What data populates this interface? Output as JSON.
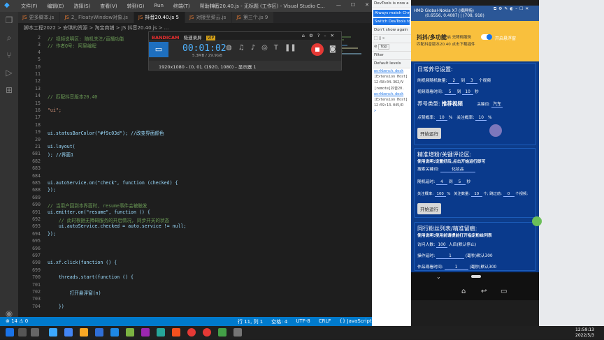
{
  "vscode": {
    "menu": [
      "文件(F)",
      "编辑(E)",
      "选择(S)",
      "查看(V)",
      "转到(G)",
      "Run",
      "终端(T)",
      "帮助(H)"
    ],
    "window_title": "抖音20.40.js - 无标题 (工作区) - Visual Studio C...",
    "tabs": [
      {
        "label": "更多脚本.js",
        "active": false
      },
      {
        "label": "2_ FloatyWindow对象.js",
        "active": false
      },
      {
        "label": "抖音20.40.js 5",
        "active": true
      },
      {
        "label": "对接至菜云.js",
        "active": false
      },
      {
        "label": "第三个.js 9",
        "active": false
      }
    ],
    "breadcrumb": "脚本工程2022 > 安琪的资源 > 淘宝商铺 > JS 抖音20.40.js > ...",
    "lines": [
      {
        "n": "2",
        "t": "  // 视频说明区: 随机关注/直播功能"
      },
      {
        "n": "3",
        "t": "  // 作者Q号: 阿里编程"
      },
      {
        "n": "4",
        "t": ""
      },
      {
        "n": "5",
        "t": ""
      },
      {
        "n": "10",
        "t": ""
      },
      {
        "n": "11",
        "t": ""
      },
      {
        "n": "12",
        "t": ""
      },
      {
        "n": "13",
        "t": ""
      },
      {
        "n": "14",
        "t": "  // 匹配抖音版本20.40"
      },
      {
        "n": "15",
        "t": ""
      },
      {
        "n": "16",
        "t": "  \"ui\";"
      },
      {
        "n": "17",
        "t": ""
      },
      {
        "n": "18",
        "t": ""
      },
      {
        "n": "19",
        "t": "  ui.statusBarColor(\"#f9c03d\"); //改变界面颜色"
      },
      {
        "n": "20",
        "t": ""
      },
      {
        "n": "21",
        "t": "  ui.layout("
      },
      {
        "n": "681",
        "t": "  ); //界面1"
      },
      {
        "n": "682",
        "t": ""
      },
      {
        "n": "683",
        "t": ""
      },
      {
        "n": "684",
        "t": ""
      },
      {
        "n": "685",
        "t": "  ui.autoService.on(\"check\", function (checked) {"
      },
      {
        "n": "688",
        "t": "  });"
      },
      {
        "n": "689",
        "t": ""
      },
      {
        "n": "690",
        "t": "  // 当用户回到本界面时, resume事件会被触发"
      },
      {
        "n": "691",
        "t": "  ui.emitter.on(\"resume\", function () {"
      },
      {
        "n": "692",
        "t": "      // 此时根据无障碍服务的开启情况, 同步开关的状态"
      },
      {
        "n": "693",
        "t": "      ui.autoService.checked = auto.service != null;"
      },
      {
        "n": "694",
        "t": "  });"
      },
      {
        "n": "695",
        "t": ""
      },
      {
        "n": "696",
        "t": ""
      },
      {
        "n": "697",
        "t": ""
      },
      {
        "n": "698",
        "t": "  ui.xf.click(function () {"
      },
      {
        "n": "699",
        "t": ""
      },
      {
        "n": "700",
        "t": "      threads.start(function () {"
      },
      {
        "n": "701",
        "t": ""
      },
      {
        "n": "702",
        "t": "          打开悬浮窗(n)"
      },
      {
        "n": "703",
        "t": ""
      },
      {
        "n": "704",
        "t": "      })"
      }
    ],
    "status_left": "⊗ 14 ⚠ 0",
    "status_right": [
      "行 11, 列 1",
      "空格: 4",
      "UTF-8",
      "CRLF",
      "{} JavaScript"
    ]
  },
  "bandicam": {
    "brand": "BANDICAM",
    "subtitle": "极速录屏",
    "vip": "VIP",
    "time": "00:01:02",
    "size": "5.3MB / 29.9GB",
    "resolution": "1920x1080 - (0, 0), (1920, 1080) - 显示器 1"
  },
  "devtools": {
    "btn1": "Always match Chrome",
    "btn2": "Switch DevTools to",
    "dont_show": "Don't show again",
    "filter": "Filter",
    "levels": "Default levels",
    "top": "top",
    "logs": [
      "workbench.desk",
      "[Extension Host]",
      "12:58:04.362/V",
      "[remote]抖音20.",
      "workbench.desk",
      "[Extension Host]",
      "12:59:13.045/D"
    ]
  },
  "phone": {
    "window_title": "HMD Global-Nokia X7 (横屏扬)",
    "window_sub": "(0.6556, 0.4087) | (708, 918)",
    "header_title": "抖抖/多功能",
    "header_opt1": "开启 无障碍服务",
    "header_opt2": "开启悬浮窗",
    "header_note": "匹配抖音版本20.40  点击下载插件",
    "card1": {
      "title": "日常养号设置:",
      "row1_a": "刷视频随机数量:",
      "row1_v1": "2",
      "row1_b": "到",
      "row1_v2": "3",
      "row1_c": "个视频",
      "row2_a": "视频观看时间:",
      "row2_v1": "5",
      "row2_b": "到",
      "row2_v2": "10",
      "row2_c": "秒",
      "type_label": "养号类型:",
      "type_value": "推荐视频",
      "kw_label": "关键词:",
      "kw_value": "汽车",
      "like_label": "点赞概率:",
      "like_v": "10",
      "pct": "%",
      "follow_label": "关注概率:",
      "follow_v": "10",
      "run": "开始运行"
    },
    "card2": {
      "title": "精准增粉/关键评论区:",
      "desc": "使用说明:设置好后,点击开始运行即可",
      "search_label": "搜索关键词:",
      "search_v": "化妆品",
      "delay_label": "随机延时:",
      "delay_v1": "4",
      "delay_b": "到",
      "delay_v2": "5",
      "delay_c": "秒",
      "rate_label": "关注概率:",
      "rate_v": "100",
      "pct": "%",
      "cnt_label": "关注数量:",
      "cnt_v": "10",
      "cnt_c": "个;",
      "skip_label": "跳过前:",
      "skip_v": "0",
      "skip_c": "个视频;",
      "run": "开始运行"
    },
    "card3": {
      "title": "同行粉丝列表/精准留痕:",
      "desc": "使用说明:使用前请提前打开指定粉丝列表",
      "visit_label": "访问人数:",
      "visit_v": "100",
      "visit_c": "人后(默认停止)",
      "op_label": "操作延时:",
      "op_v": "1",
      "op_c": "(毫秒)默认300",
      "work_label": "作品观看时间:",
      "work_v": "1",
      "work_c": "(毫秒)默认300"
    }
  },
  "taskbar": {
    "time": "12:59:13",
    "date": "2022/5/3"
  }
}
